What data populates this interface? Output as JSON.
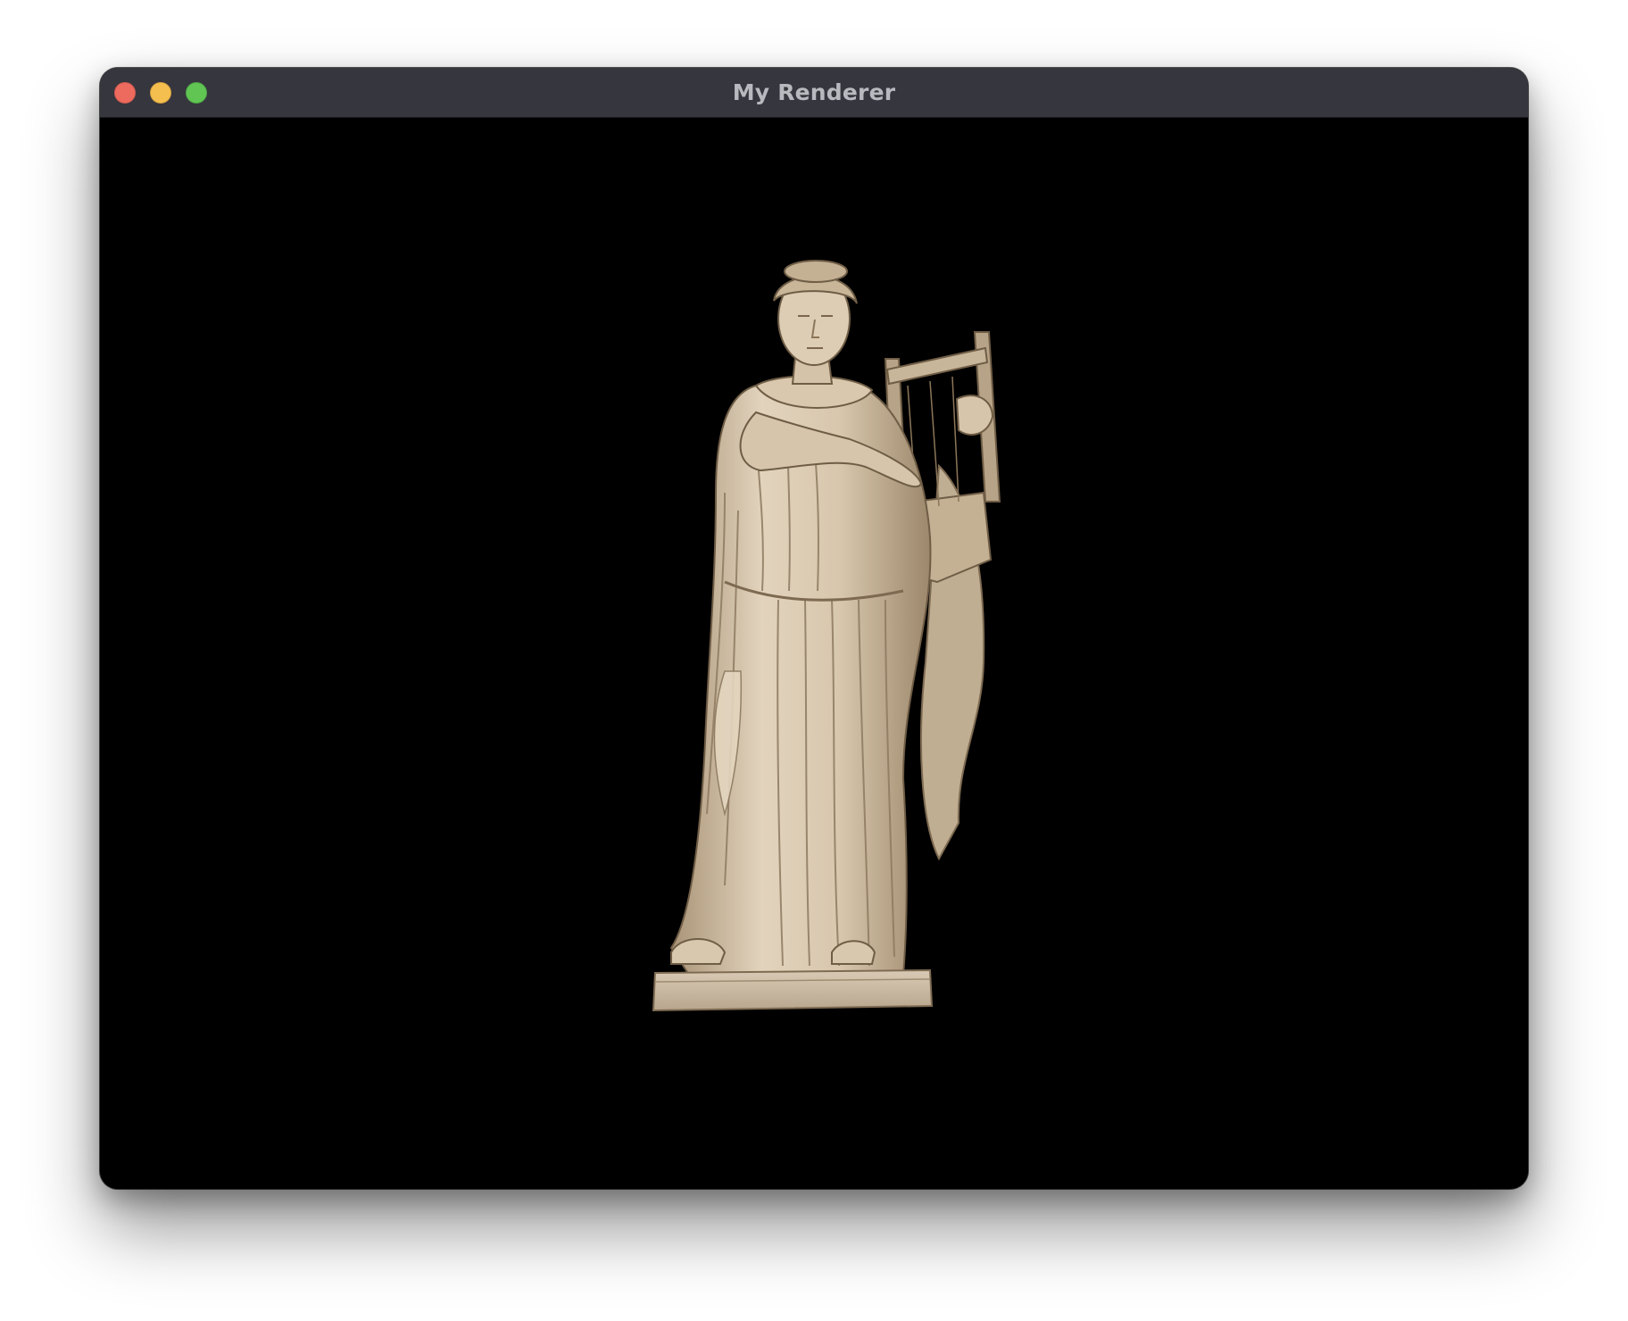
{
  "window": {
    "title": "My Renderer",
    "controls": {
      "close_icon": "close-button-red",
      "minimize_icon": "minimize-button-yellow",
      "zoom_icon": "zoom-button-green"
    },
    "colors": {
      "titlebar": "#36363e",
      "viewport_background": "#000000",
      "close": "#ed6a5e",
      "minimize": "#f5bf4f",
      "zoom": "#61c554"
    }
  },
  "viewport": {
    "content": "rendered-statue-model",
    "colors": {
      "marble_light": "#e2d3bd",
      "marble_mid": "#c7b497",
      "marble_shadow": "#8f7c62"
    }
  }
}
